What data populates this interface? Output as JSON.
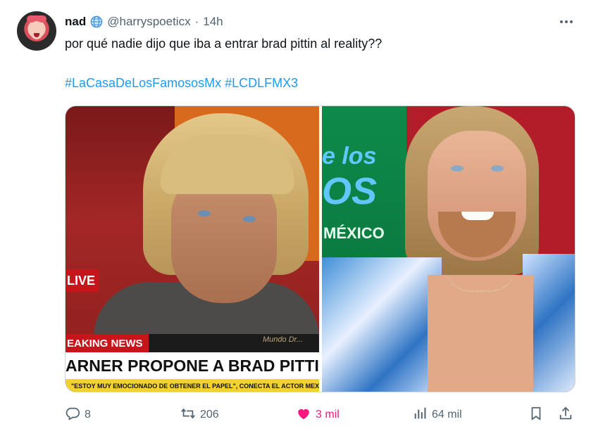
{
  "tweet": {
    "name": "nad",
    "handle": "@harryspoeticx",
    "separator": "·",
    "time": "14h",
    "text": "por qué nadie dijo que iba a entrar brad pittin al reality??",
    "hashtags": [
      "#LaCasaDeLosFamososMx",
      "#LCDLFMX3"
    ]
  },
  "media": {
    "left": {
      "live_label": "LIVE",
      "breaking_label": "EAKING NEWS",
      "channel_logo": "Mundo Dr...",
      "headline": "ARNER PROPONE A BRAD PITTIN COMO GRINDELWA",
      "subline": "\"ESTOY MUY EMOCIONADO DE OBTENER EL PAPEL\", CONECTA EL ACTOR MEXICA"
    },
    "right": {
      "brand_line1": "e los",
      "brand_line2": "OS",
      "brand_line3": "MÉXICO"
    }
  },
  "actions": {
    "replies": "8",
    "retweets": "206",
    "likes": "3 mil",
    "views": "64 mil",
    "like_color": "#f91880",
    "icon_color": "#536471",
    "icons": [
      "reply-icon",
      "retweet-icon",
      "like-icon",
      "views-icon",
      "bookmark-icon",
      "share-icon"
    ]
  },
  "colors": {
    "hashtag": "#1d9bf0",
    "text": "#0f1419",
    "muted": "#536471"
  }
}
